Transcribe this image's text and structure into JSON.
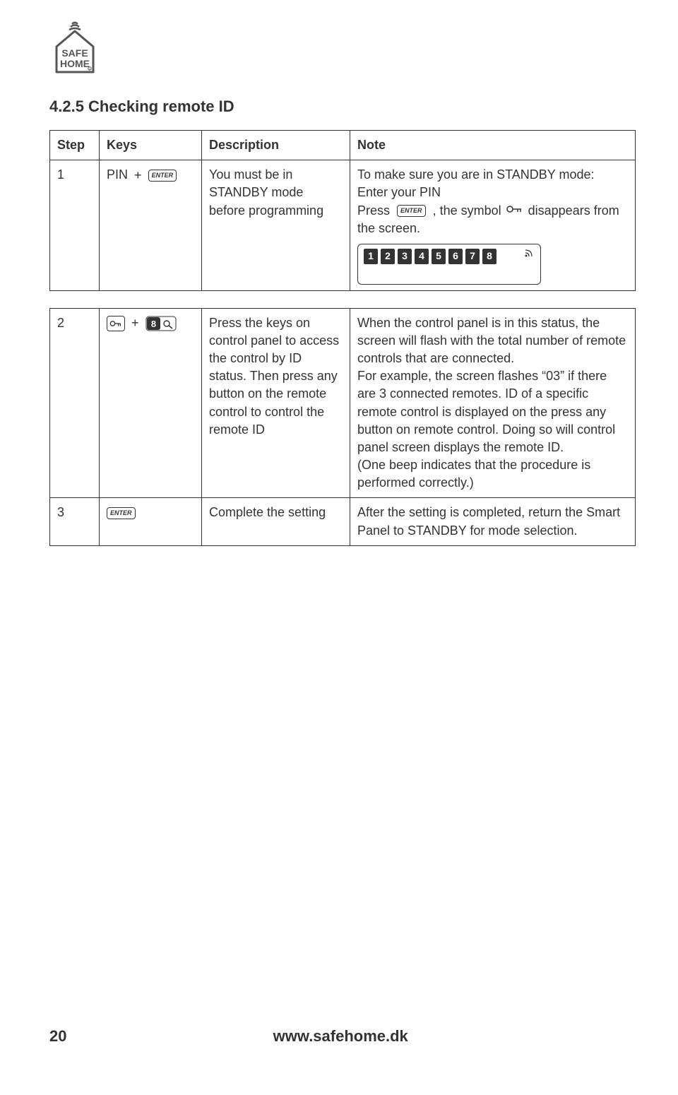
{
  "logo": {
    "line1": "SAFE",
    "line2": "HOME"
  },
  "title": "4.2.5 Checking remote ID",
  "headers": {
    "step": "Step",
    "keys": "Keys",
    "desc": "Description",
    "note": "Note"
  },
  "rows": [
    {
      "step": "1",
      "keys_prefix": "PIN",
      "keys_enter_label": "ENTER",
      "desc": "You must be in STANDBY mode before programming",
      "note_parts": {
        "line1": "To make sure you are in STANDBY mode:",
        "line2": "Enter your PIN",
        "press": "Press",
        "enter_label": "ENTER",
        "symbol_text": ", the symbol",
        "tail": "disappears from the screen."
      },
      "lcd_digits": [
        "1",
        "2",
        "3",
        "4",
        "5",
        "6",
        "7",
        "8"
      ]
    },
    {
      "step": "2",
      "desc": "Press the keys on control panel to access the control by ID status. Then press any button on the remote control to control the remote ID",
      "note": "When the control panel is in this status, the screen will flash with the total number of remote controls that are connected.\nFor example, the screen flashes “03” if there are 3 connected remotes. ID of a specific remote control is displayed on the press any button on remote control. Doing so will control panel screen displays the remote ID.\n(One beep indicates that the procedure is performed correctly.)"
    },
    {
      "step": "3",
      "keys_enter_label": "ENTER",
      "desc": "Complete the setting",
      "note": "After the setting is completed, return the Smart Panel to STANDBY for mode selection."
    }
  ],
  "footer": {
    "page": "20",
    "url": "www.safehome.dk"
  }
}
